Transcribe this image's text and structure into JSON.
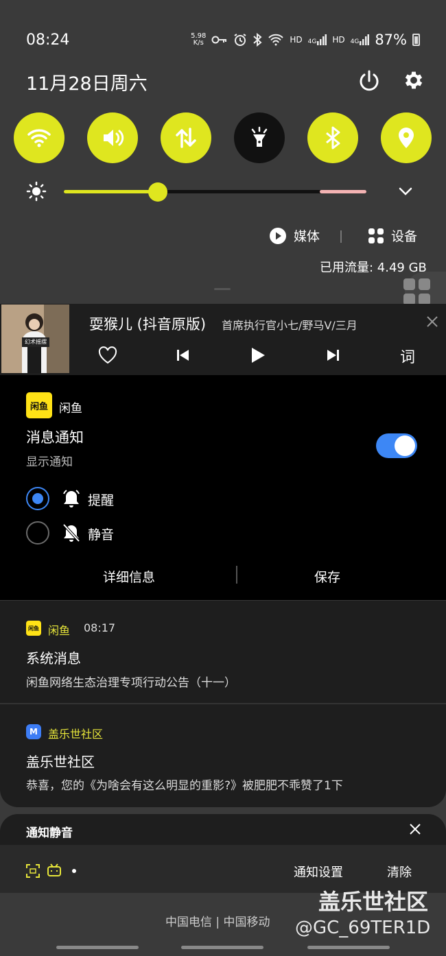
{
  "status_bar": {
    "time": "08:24",
    "speed_value": "5.98",
    "speed_unit": "K/s",
    "hd1": "HD",
    "g1": "4G",
    "hd2": "HD",
    "g2": "4G",
    "battery": "87%"
  },
  "header": {
    "date": "11月28日周六"
  },
  "quick_toggles": [
    {
      "icon": "wifi-icon",
      "active": true
    },
    {
      "icon": "sound-icon",
      "active": true
    },
    {
      "icon": "mobile-data-icon",
      "active": true
    },
    {
      "icon": "flashlight-icon",
      "active": false
    },
    {
      "icon": "bluetooth-icon",
      "active": true
    },
    {
      "icon": "location-icon",
      "active": true
    }
  ],
  "brightness": {
    "level": 0.31
  },
  "media_output": {
    "media_label": "媒体",
    "device_label": "设备"
  },
  "data_usage": "已用流量: 4.49 GB",
  "music": {
    "cover_banner": "幻术摇摆",
    "song": "耍猴儿 (抖音原版)",
    "artist": "首席执行官小七/野马V/三月",
    "lyrics_label": "词"
  },
  "channel_settings": {
    "app_icon_text": "闲鱼",
    "app_name": "闲鱼",
    "title": "消息通知",
    "subtitle": "显示通知",
    "enabled": true,
    "option_alert": "提醒",
    "option_silent": "静音",
    "details_button": "详细信息",
    "save_button": "保存"
  },
  "notifications": [
    {
      "app": "闲鱼",
      "time": "08:17",
      "title": "系统消息",
      "body": "闲鱼网络生态治理专项行动公告（十一）"
    },
    {
      "app": "盖乐世社区",
      "icon_text": "M",
      "title": "盖乐世社区",
      "body": "恭喜，您的《为啥会有这么明显的重影?》被肥肥不乖赞了1下"
    }
  ],
  "silent_section": {
    "title": "通知静音"
  },
  "bottom": {
    "notif_settings": "通知设置",
    "clear": "清除",
    "carrier": "中国电信 | 中国移动"
  },
  "watermark": {
    "line1": "盖乐世社区",
    "line2": "@GC_69TER1D"
  },
  "colors": {
    "accent": "#dfe61f",
    "toggle_on": "#3d87f5"
  }
}
